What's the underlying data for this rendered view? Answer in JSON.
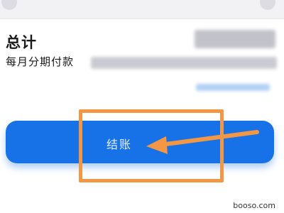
{
  "summary": {
    "total_label": "总计",
    "installment_label": "每月分期付款"
  },
  "checkout": {
    "button_label": "结账"
  },
  "watermark": "booso.com",
  "colors": {
    "button": "#1672e6",
    "annotation": "#f39745"
  }
}
